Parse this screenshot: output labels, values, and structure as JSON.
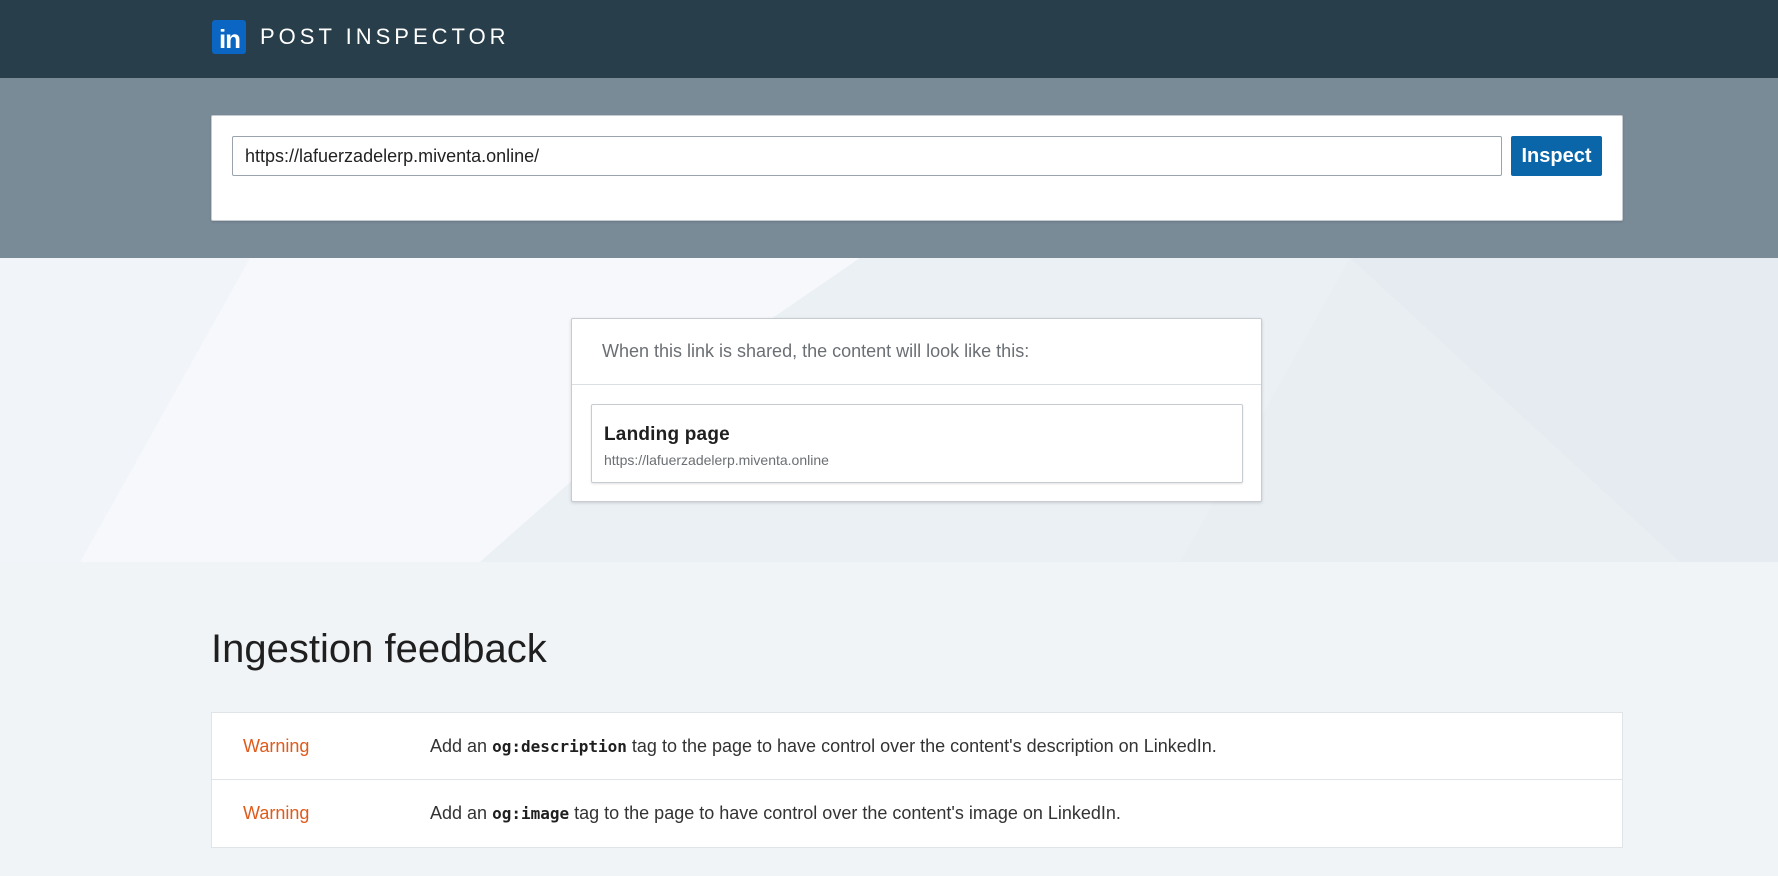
{
  "header": {
    "logo_text": "in",
    "title": "POST INSPECTOR"
  },
  "search": {
    "url_value": "https://lafuerzadelerp.miventa.online/",
    "button_label": "Inspect"
  },
  "preview": {
    "intro": "When this link is shared, the content will look like this:",
    "title": "Landing page",
    "url": "https://lafuerzadelerp.miventa.online"
  },
  "feedback": {
    "heading": "Ingestion feedback",
    "rows": [
      {
        "level": "Warning",
        "before": "Add an ",
        "code": "og:description",
        "after": " tag to the page to have control over the content's description on LinkedIn."
      },
      {
        "level": "Warning",
        "before": "Add an ",
        "code": "og:image",
        "after": " tag to the page to have control over the content's image on LinkedIn."
      }
    ]
  },
  "colors": {
    "header_bg": "#283e4a",
    "search_band_bg": "#7a8b98",
    "button_bg": "#0a66a8",
    "warning": "#e05a1a",
    "logo": "#0a66c2"
  }
}
